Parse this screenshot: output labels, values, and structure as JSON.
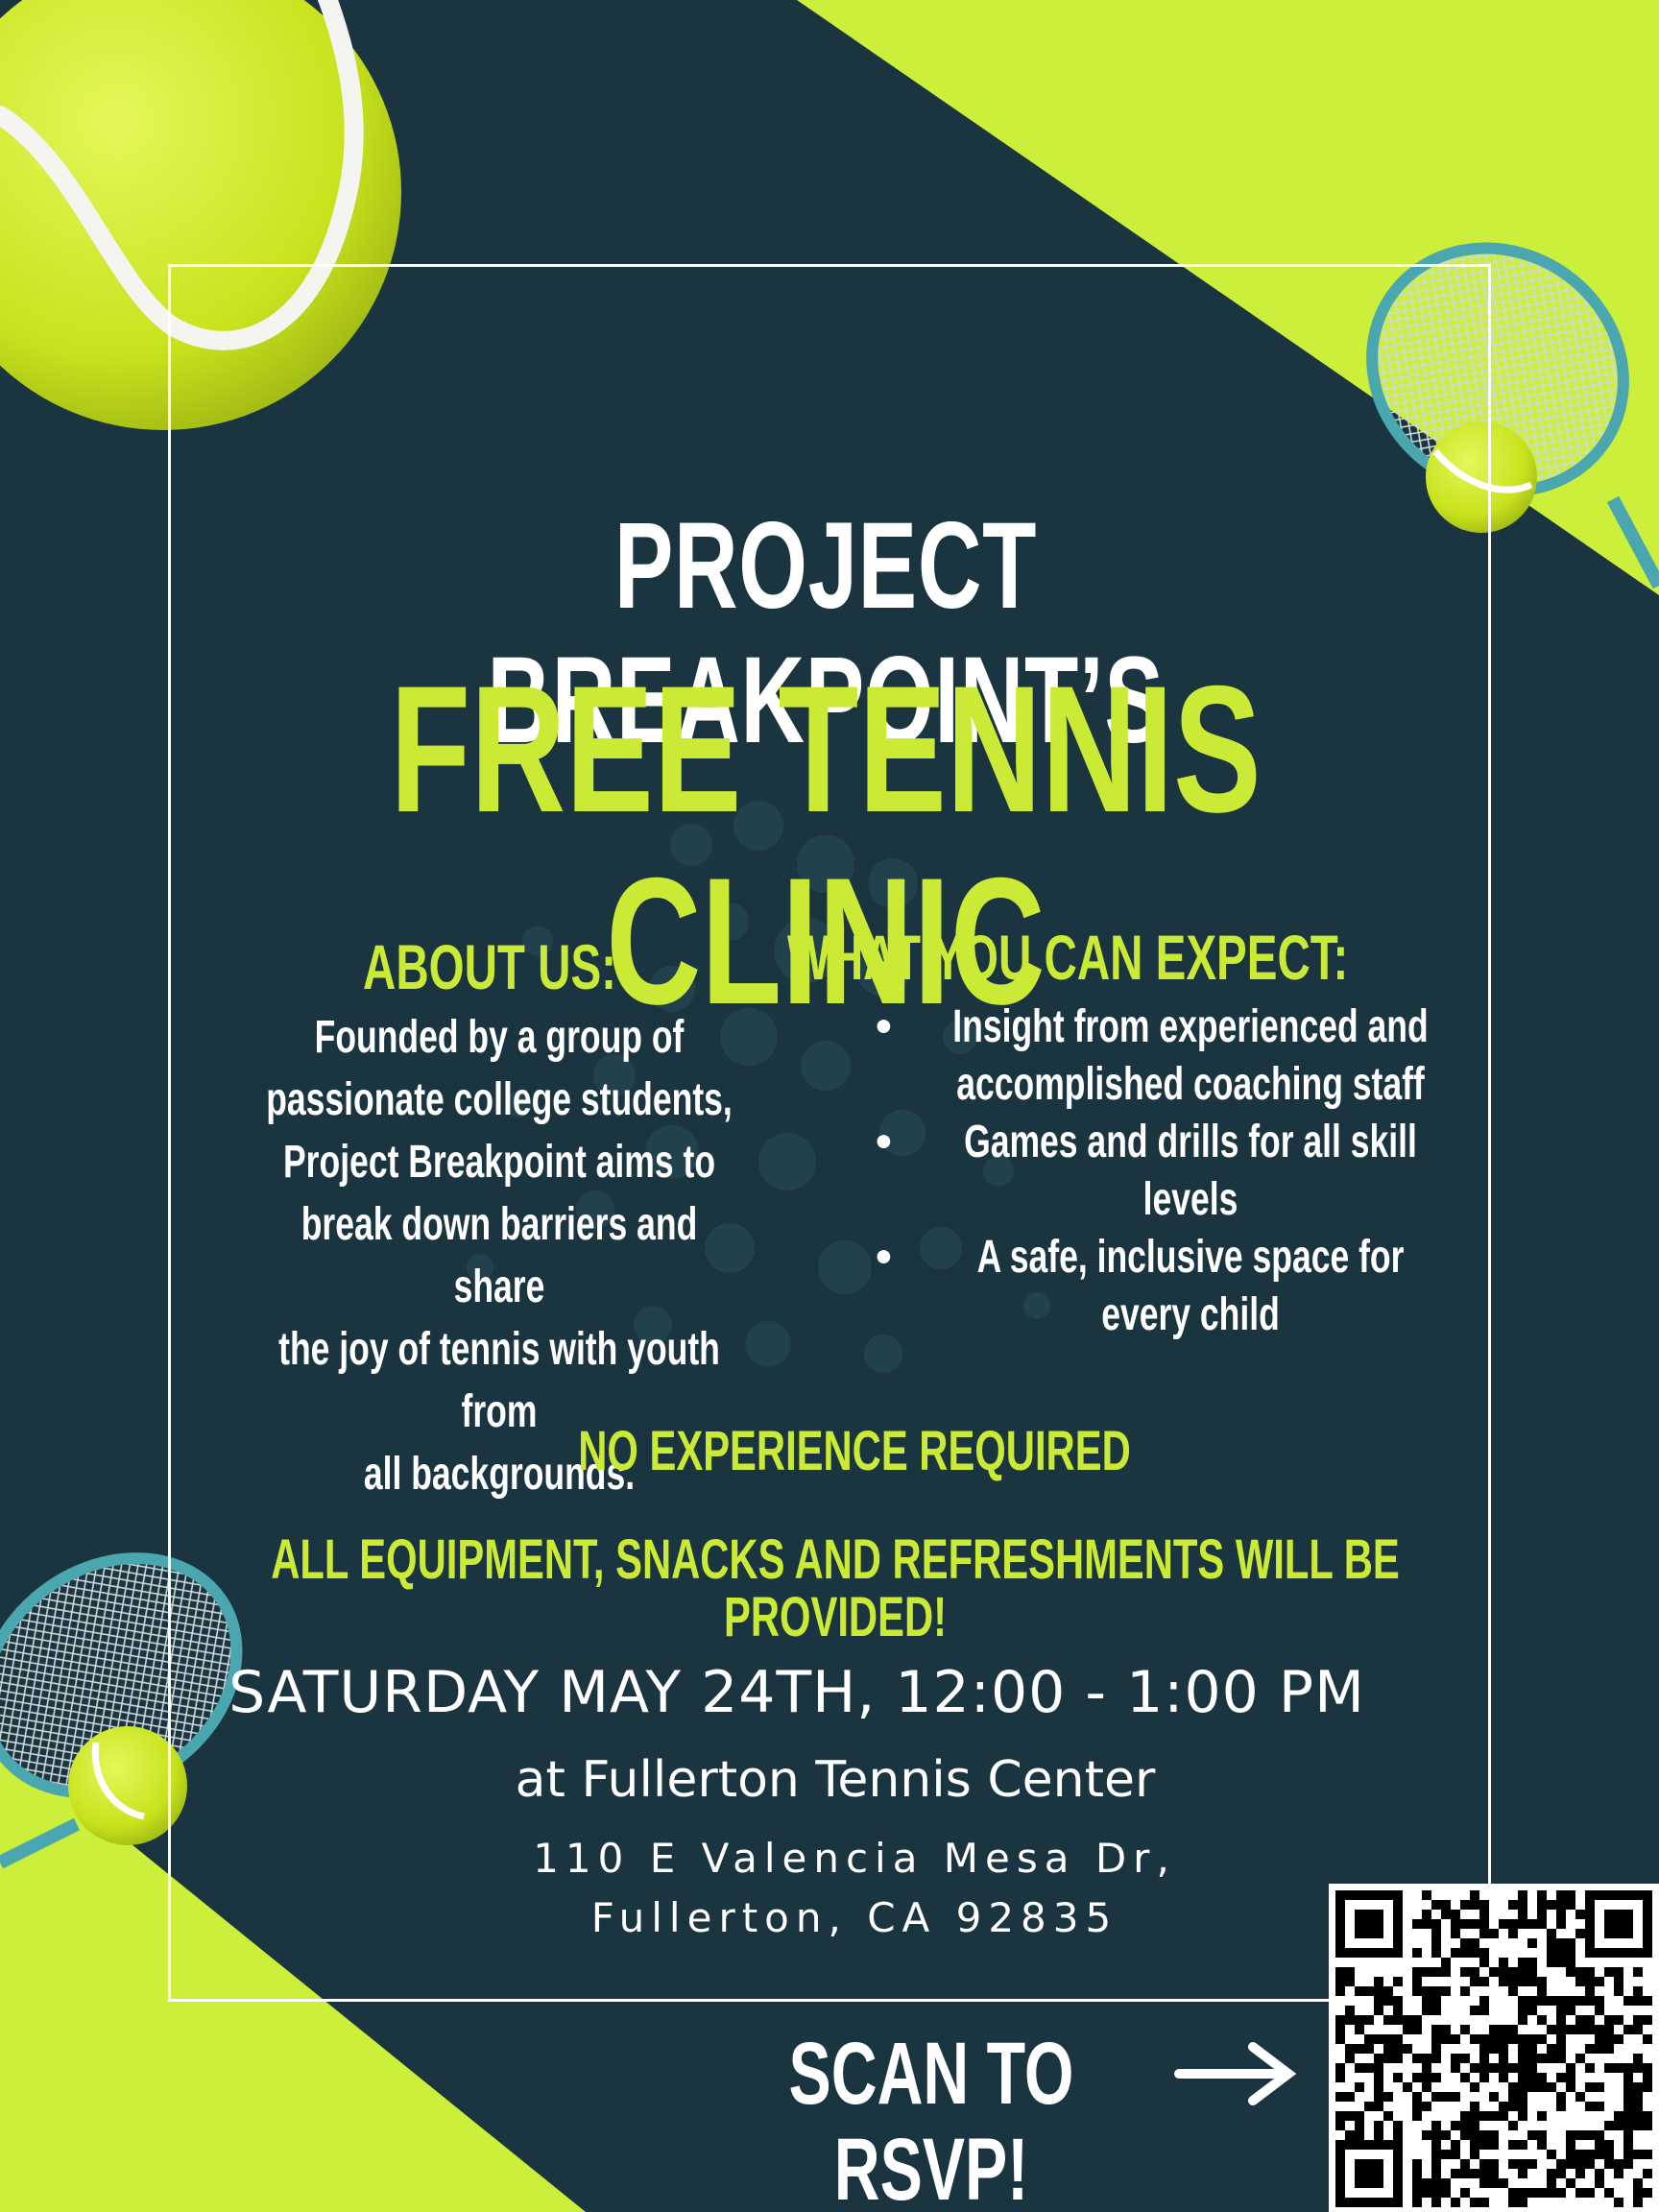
{
  "header": {
    "title_line1": "PROJECT BREAKPOINT’S",
    "title_line2": "FREE TENNIS CLINIC"
  },
  "about": {
    "heading": "ABOUT US:",
    "body_lines": [
      "Founded by a group of",
      "passionate college students,",
      "Project Breakpoint aims to",
      "break down barriers and share",
      "the joy of tennis with youth from",
      "all backgrounds."
    ]
  },
  "expect": {
    "heading": "WHAT YOU CAN EXPECT:",
    "items": [
      "Insight from experienced and accomplished coaching staff",
      "Games and drills for all skill levels",
      "A safe, inclusive space for every child"
    ]
  },
  "notes": {
    "no_experience": "NO EXPERIENCE REQUIRED",
    "provided": "ALL EQUIPMENT, SNACKS AND REFRESHMENTS WILL BE PROVIDED!"
  },
  "event": {
    "date_time": "SATURDAY MAY 24TH, 12:00 - 1:00 PM",
    "venue": "at Fullerton Tennis Center",
    "address_line1": "110 E Valencia Mesa Dr,",
    "address_line2": "Fullerton, CA 92835"
  },
  "rsvp": {
    "label": "SCAN TO RSVP!",
    "arrow": "→"
  },
  "colors": {
    "background": "#1b3540",
    "accent": "#cbea36",
    "text": "#ffffff",
    "racket": "#4aa7b0"
  },
  "icons": {
    "ball": "tennis-ball-icon",
    "racket": "tennis-racket-icon",
    "qr": "qr-code-icon"
  }
}
